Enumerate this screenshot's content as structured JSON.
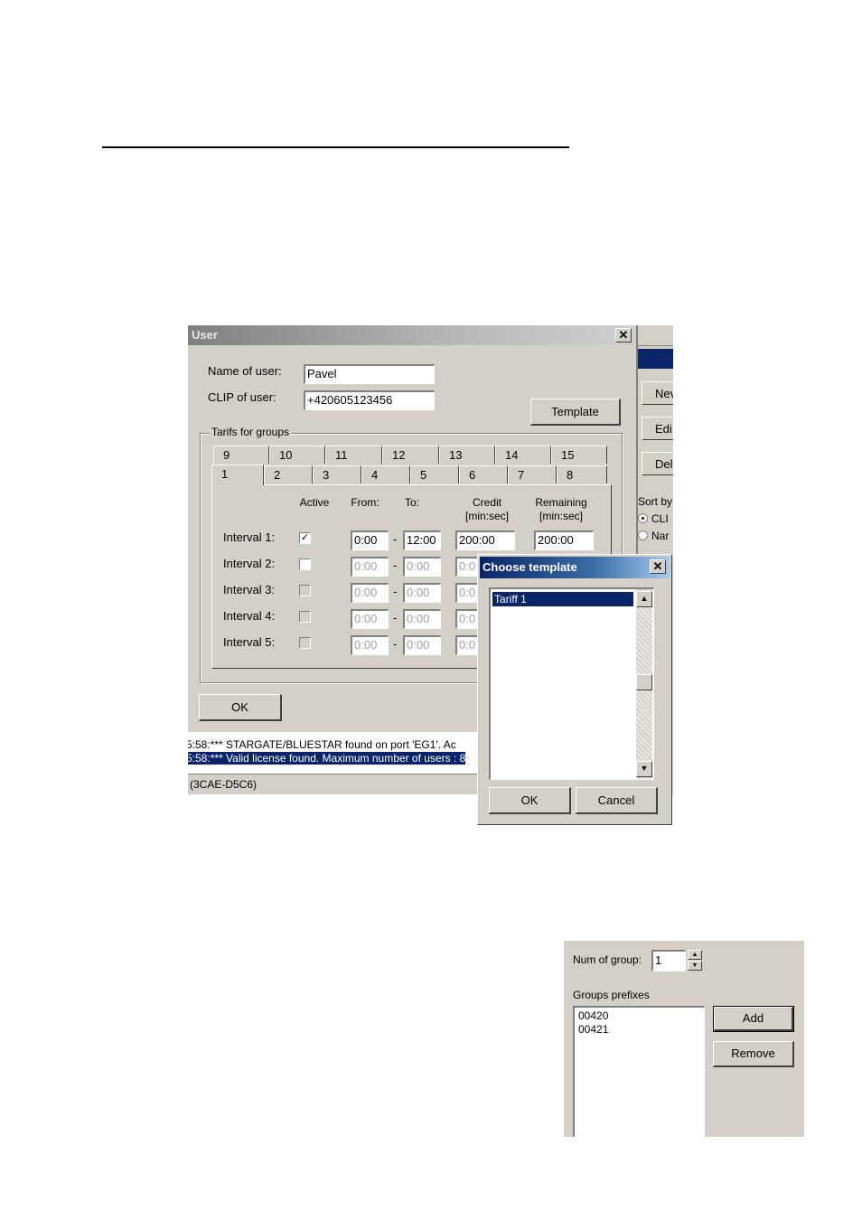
{
  "user_dialog": {
    "title": "User",
    "close_glyph": "✕",
    "name_label": "Name of user:",
    "name_value": "Pavel",
    "clip_label": "CLIP of user:",
    "clip_value": "+420605123456",
    "template_button": "Template",
    "group_box_label": "Tarifs for groups",
    "tabs_row1": [
      "9",
      "10",
      "11",
      "12",
      "13",
      "14",
      "15"
    ],
    "tabs_row2": [
      "1",
      "2",
      "3",
      "4",
      "5",
      "6",
      "7",
      "8"
    ],
    "selected_tab": "1",
    "headers": {
      "active": "Active",
      "from": "From:",
      "to": "To:",
      "credit": "Credit",
      "credit_unit": "[min:sec]",
      "remaining": "Remaining",
      "remaining_unit": "[min:sec]"
    },
    "intervals": [
      {
        "label": "Interval 1:",
        "active": true,
        "from": "0:00",
        "to": "12:00",
        "credit": "200:00",
        "remaining": "200:00"
      },
      {
        "label": "Interval 2:",
        "active": false,
        "from": "0:00",
        "to": "0:00",
        "credit": "0:0"
      },
      {
        "label": "Interval 3:",
        "active": false,
        "from": "0:00",
        "to": "0:00",
        "credit": "0:0"
      },
      {
        "label": "Interval 4:",
        "active": false,
        "from": "0:00",
        "to": "0:00",
        "credit": "0:0"
      },
      {
        "label": "Interval 5:",
        "active": false,
        "from": "0:00",
        "to": "0:00",
        "credit": "0:0"
      }
    ],
    "dash": "-",
    "ok_button": "OK"
  },
  "main_window": {
    "right_buttons": [
      "Nev",
      "Edi",
      "Dele"
    ],
    "sort_label": "Sort by",
    "sort_options": [
      {
        "label": "CLI",
        "selected": true
      },
      {
        "label": "Nar",
        "selected": false
      }
    ],
    "log_lines": [
      "5:58:*** STARGATE/BLUESTAR found on port 'EG1'. Ac",
      "5:58:*** Valid license found. Maximum number of users : 8"
    ],
    "status_text": "(3CAE-D5C6)"
  },
  "choose_template": {
    "title": "Choose template",
    "close_glyph": "✕",
    "items": [
      "Tariff 1"
    ],
    "selected": "Tariff 1",
    "ok_button": "OK",
    "cancel_button": "Cancel"
  },
  "groups_panel": {
    "num_label": "Num of group:",
    "num_value": "1",
    "prefixes_label": "Groups prefixes",
    "prefixes": [
      "00420",
      "00421"
    ],
    "add_button": "Add",
    "remove_button": "Remove"
  },
  "icons": {
    "check": "✓",
    "arrow_up": "▲",
    "arrow_down": "▼"
  }
}
